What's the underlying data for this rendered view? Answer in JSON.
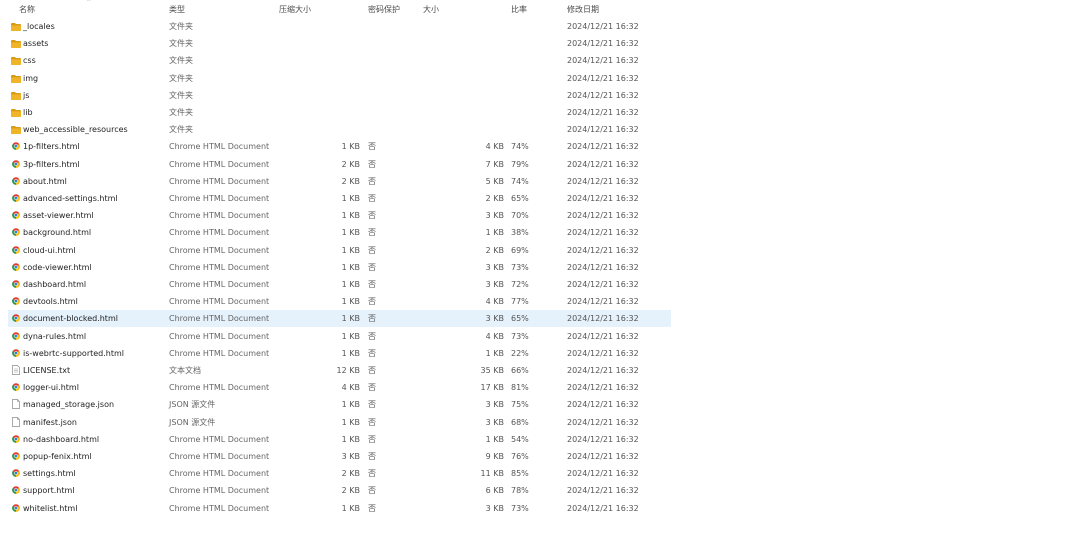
{
  "columns": {
    "name": "名称",
    "type": "类型",
    "packed": "压缩大小",
    "password": "密码保护",
    "size": "大小",
    "ratio": "比率",
    "modified": "修改日期"
  },
  "icons": {
    "folder": "folder-icon",
    "chrome": "chrome-html-document-icon",
    "txt": "text-document-icon",
    "json": "json-file-icon",
    "sort": "sort-chevron-icon"
  },
  "colors": {
    "folder": "#f0b429",
    "folder_dark": "#d99a14",
    "selection": "#e5f1fb"
  },
  "selected_index": 17,
  "files": [
    {
      "icon": "folder",
      "name": "_locales",
      "type": "文件夹",
      "packed": "",
      "password": "",
      "size": "",
      "ratio": "",
      "modified": "2024/12/21 16:32"
    },
    {
      "icon": "folder",
      "name": "assets",
      "type": "文件夹",
      "packed": "",
      "password": "",
      "size": "",
      "ratio": "",
      "modified": "2024/12/21 16:32"
    },
    {
      "icon": "folder",
      "name": "css",
      "type": "文件夹",
      "packed": "",
      "password": "",
      "size": "",
      "ratio": "",
      "modified": "2024/12/21 16:32"
    },
    {
      "icon": "folder",
      "name": "img",
      "type": "文件夹",
      "packed": "",
      "password": "",
      "size": "",
      "ratio": "",
      "modified": "2024/12/21 16:32"
    },
    {
      "icon": "folder",
      "name": "js",
      "type": "文件夹",
      "packed": "",
      "password": "",
      "size": "",
      "ratio": "",
      "modified": "2024/12/21 16:32"
    },
    {
      "icon": "folder",
      "name": "lib",
      "type": "文件夹",
      "packed": "",
      "password": "",
      "size": "",
      "ratio": "",
      "modified": "2024/12/21 16:32"
    },
    {
      "icon": "folder",
      "name": "web_accessible_resources",
      "type": "文件夹",
      "packed": "",
      "password": "",
      "size": "",
      "ratio": "",
      "modified": "2024/12/21 16:32"
    },
    {
      "icon": "chrome",
      "name": "1p-filters.html",
      "type": "Chrome HTML Document",
      "packed": "1 KB",
      "password": "否",
      "size": "4 KB",
      "ratio": "74%",
      "modified": "2024/12/21 16:32"
    },
    {
      "icon": "chrome",
      "name": "3p-filters.html",
      "type": "Chrome HTML Document",
      "packed": "2 KB",
      "password": "否",
      "size": "7 KB",
      "ratio": "79%",
      "modified": "2024/12/21 16:32"
    },
    {
      "icon": "chrome",
      "name": "about.html",
      "type": "Chrome HTML Document",
      "packed": "2 KB",
      "password": "否",
      "size": "5 KB",
      "ratio": "74%",
      "modified": "2024/12/21 16:32"
    },
    {
      "icon": "chrome",
      "name": "advanced-settings.html",
      "type": "Chrome HTML Document",
      "packed": "1 KB",
      "password": "否",
      "size": "2 KB",
      "ratio": "65%",
      "modified": "2024/12/21 16:32"
    },
    {
      "icon": "chrome",
      "name": "asset-viewer.html",
      "type": "Chrome HTML Document",
      "packed": "1 KB",
      "password": "否",
      "size": "3 KB",
      "ratio": "70%",
      "modified": "2024/12/21 16:32"
    },
    {
      "icon": "chrome",
      "name": "background.html",
      "type": "Chrome HTML Document",
      "packed": "1 KB",
      "password": "否",
      "size": "1 KB",
      "ratio": "38%",
      "modified": "2024/12/21 16:32"
    },
    {
      "icon": "chrome",
      "name": "cloud-ui.html",
      "type": "Chrome HTML Document",
      "packed": "1 KB",
      "password": "否",
      "size": "2 KB",
      "ratio": "69%",
      "modified": "2024/12/21 16:32"
    },
    {
      "icon": "chrome",
      "name": "code-viewer.html",
      "type": "Chrome HTML Document",
      "packed": "1 KB",
      "password": "否",
      "size": "3 KB",
      "ratio": "73%",
      "modified": "2024/12/21 16:32"
    },
    {
      "icon": "chrome",
      "name": "dashboard.html",
      "type": "Chrome HTML Document",
      "packed": "1 KB",
      "password": "否",
      "size": "3 KB",
      "ratio": "72%",
      "modified": "2024/12/21 16:32"
    },
    {
      "icon": "chrome",
      "name": "devtools.html",
      "type": "Chrome HTML Document",
      "packed": "1 KB",
      "password": "否",
      "size": "4 KB",
      "ratio": "77%",
      "modified": "2024/12/21 16:32"
    },
    {
      "icon": "chrome",
      "name": "document-blocked.html",
      "type": "Chrome HTML Document",
      "packed": "1 KB",
      "password": "否",
      "size": "3 KB",
      "ratio": "65%",
      "modified": "2024/12/21 16:32"
    },
    {
      "icon": "chrome",
      "name": "dyna-rules.html",
      "type": "Chrome HTML Document",
      "packed": "1 KB",
      "password": "否",
      "size": "4 KB",
      "ratio": "73%",
      "modified": "2024/12/21 16:32"
    },
    {
      "icon": "chrome",
      "name": "is-webrtc-supported.html",
      "type": "Chrome HTML Document",
      "packed": "1 KB",
      "password": "否",
      "size": "1 KB",
      "ratio": "22%",
      "modified": "2024/12/21 16:32"
    },
    {
      "icon": "txt",
      "name": "LICENSE.txt",
      "type": "文本文档",
      "packed": "12 KB",
      "password": "否",
      "size": "35 KB",
      "ratio": "66%",
      "modified": "2024/12/21 16:32"
    },
    {
      "icon": "chrome",
      "name": "logger-ui.html",
      "type": "Chrome HTML Document",
      "packed": "4 KB",
      "password": "否",
      "size": "17 KB",
      "ratio": "81%",
      "modified": "2024/12/21 16:32"
    },
    {
      "icon": "json",
      "name": "managed_storage.json",
      "type": "JSON 源文件",
      "packed": "1 KB",
      "password": "否",
      "size": "3 KB",
      "ratio": "75%",
      "modified": "2024/12/21 16:32"
    },
    {
      "icon": "json",
      "name": "manifest.json",
      "type": "JSON 源文件",
      "packed": "1 KB",
      "password": "否",
      "size": "3 KB",
      "ratio": "68%",
      "modified": "2024/12/21 16:32"
    },
    {
      "icon": "chrome",
      "name": "no-dashboard.html",
      "type": "Chrome HTML Document",
      "packed": "1 KB",
      "password": "否",
      "size": "1 KB",
      "ratio": "54%",
      "modified": "2024/12/21 16:32"
    },
    {
      "icon": "chrome",
      "name": "popup-fenix.html",
      "type": "Chrome HTML Document",
      "packed": "3 KB",
      "password": "否",
      "size": "9 KB",
      "ratio": "76%",
      "modified": "2024/12/21 16:32"
    },
    {
      "icon": "chrome",
      "name": "settings.html",
      "type": "Chrome HTML Document",
      "packed": "2 KB",
      "password": "否",
      "size": "11 KB",
      "ratio": "85%",
      "modified": "2024/12/21 16:32"
    },
    {
      "icon": "chrome",
      "name": "support.html",
      "type": "Chrome HTML Document",
      "packed": "2 KB",
      "password": "否",
      "size": "6 KB",
      "ratio": "78%",
      "modified": "2024/12/21 16:32"
    },
    {
      "icon": "chrome",
      "name": "whitelist.html",
      "type": "Chrome HTML Document",
      "packed": "1 KB",
      "password": "否",
      "size": "3 KB",
      "ratio": "73%",
      "modified": "2024/12/21 16:32"
    }
  ]
}
